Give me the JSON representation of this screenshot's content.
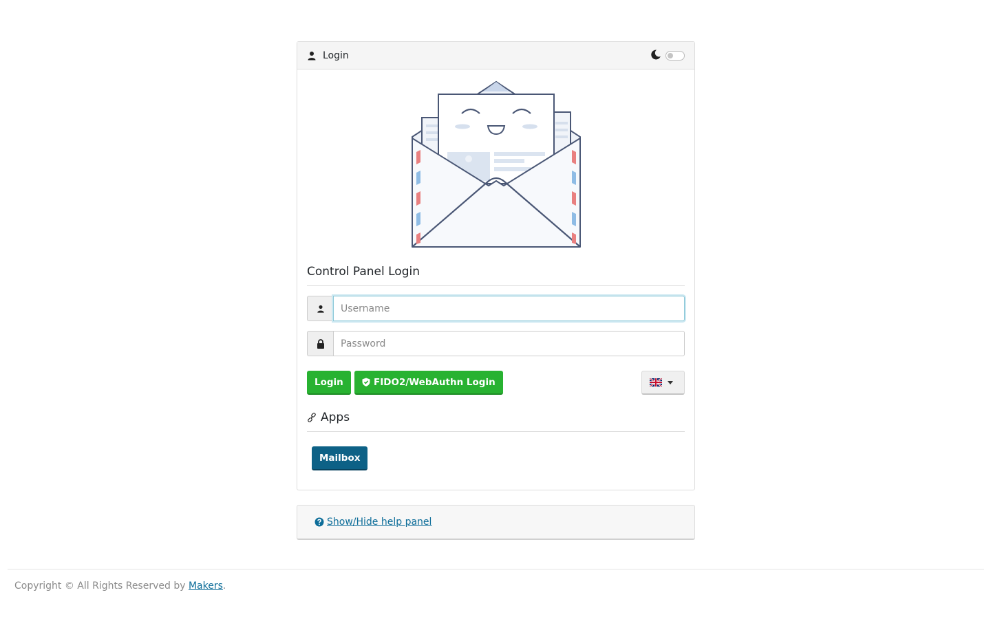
{
  "header": {
    "title": "Login",
    "user_icon": "user-icon",
    "theme_icon": "moon-icon"
  },
  "login_section": {
    "title": "Control Panel Login",
    "username_placeholder": "Username",
    "password_placeholder": "Password",
    "login_button": "Login",
    "fido_button": "FIDO2/WebAuthn Login",
    "language_flag": "uk-flag-icon"
  },
  "apps_section": {
    "title": "Apps",
    "mailbox_button": "Mailbox"
  },
  "help": {
    "link_text": "Show/Hide help panel"
  },
  "footer": {
    "prefix": "Copyright © All Rights Reserved by ",
    "link_text": "Makers",
    "suffix": "."
  },
  "colors": {
    "green": "#28b231",
    "blue": "#0d6186",
    "link": "#0d6d99"
  }
}
